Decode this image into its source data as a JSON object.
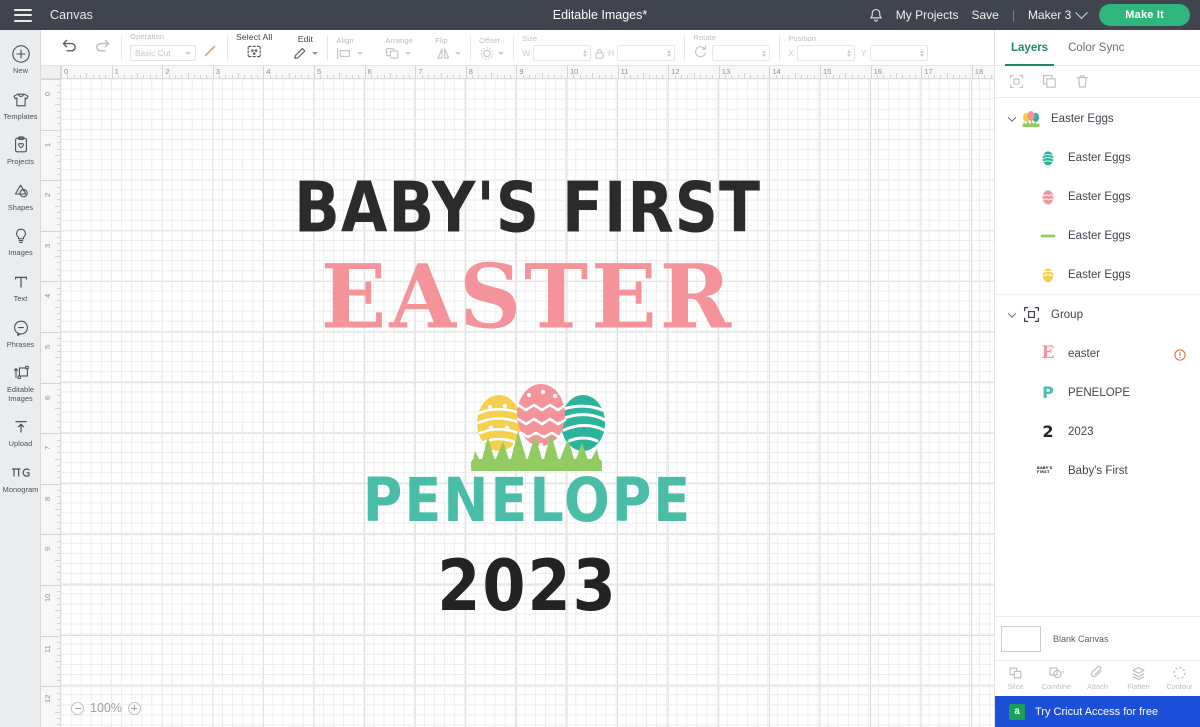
{
  "topbar": {
    "menu_icon": "hamburger-icon",
    "canvas_label": "Canvas",
    "title": "Editable Images*",
    "bell_icon": "notification-bell-icon",
    "my_projects": "My Projects",
    "save": "Save",
    "separator": "|",
    "machine": "Maker 3",
    "make_it": "Make It",
    "accent_green": "#2eb67d",
    "bar_bg": "#3f444e"
  },
  "rail": {
    "items": [
      {
        "label": "New",
        "icon": "plus-circle-icon"
      },
      {
        "label": "Templates",
        "icon": "tshirt-icon"
      },
      {
        "label": "Projects",
        "icon": "clipboard-heart-icon"
      },
      {
        "label": "Shapes",
        "icon": "shapes-icon"
      },
      {
        "label": "Images",
        "icon": "lightbulb-icon"
      },
      {
        "label": "Text",
        "icon": "text-t-icon"
      },
      {
        "label": "Phrases",
        "icon": "speech-bubble-icon"
      },
      {
        "label": "Editable\nImages",
        "icon": "editable-images-icon"
      },
      {
        "label": "Upload",
        "icon": "upload-arrow-icon"
      },
      {
        "label": "Monogram",
        "icon": "monogram-icon"
      }
    ]
  },
  "toolbar": {
    "undo": "undo-icon",
    "redo": "redo-icon",
    "operation_caption": "Operation",
    "operation_value": "Basic Cut",
    "select_all": "Select All",
    "edit": "Edit",
    "align": "Align",
    "arrange": "Arrange",
    "flip": "Flip",
    "offset": "Offset",
    "size": "Size",
    "size_w_label": "W",
    "size_w_value": "",
    "size_h_label": "H",
    "size_h_value": "",
    "lock_icon": "lock-icon",
    "rotate": "Rotate",
    "rotate_value": "",
    "position": "Position",
    "position_x_label": "X",
    "position_x_value": "",
    "position_y_label": "Y",
    "position_y_value": ""
  },
  "canvas": {
    "ruler_h_labels": [
      "0",
      "1",
      "2",
      "3",
      "4",
      "5",
      "6",
      "7",
      "8",
      "9",
      "10",
      "11",
      "12",
      "13",
      "14",
      "15",
      "16",
      "17",
      "18"
    ],
    "ruler_v_labels": [
      "0",
      "1",
      "2",
      "3",
      "4",
      "5",
      "6",
      "7",
      "8",
      "9",
      "10",
      "11",
      "12"
    ],
    "zoom_minus_icon": "zoom-out-icon",
    "zoom_level": "100%",
    "zoom_plus_icon": "zoom-in-icon",
    "design": {
      "line1": "BABY'S FIRST",
      "line1_color": "#2b2b2b",
      "line2": "EASTER",
      "line2_color": "#f4939a",
      "line3": "PENELOPE",
      "line3_color": "#49bda8",
      "line4": "2023",
      "line4_color": "#232323",
      "artwork": "easter-eggs-in-grass",
      "egg_colors": [
        "#f6cf4e",
        "#f4939a",
        "#2bb39c"
      ],
      "grass_color": "#92cb62"
    }
  },
  "right_panel": {
    "tabs": [
      {
        "label": "Layers",
        "active": true
      },
      {
        "label": "Color Sync",
        "active": false
      }
    ],
    "tools": [
      "group-icon",
      "duplicate-icon",
      "delete-icon"
    ],
    "layers": [
      {
        "label": "Easter Eggs",
        "type": "group",
        "expanded": true,
        "thumb": "multicolor-eggs-thumb",
        "thumb_color": "#92cb62",
        "children": [
          {
            "label": "Easter Eggs",
            "thumb": "teal-egg-thumb",
            "thumb_color": "#2bb39c"
          },
          {
            "label": "Easter Eggs",
            "thumb": "pink-egg-thumb",
            "thumb_color": "#f4939a"
          },
          {
            "label": "Easter Eggs",
            "thumb": "green-grass-thumb",
            "thumb_color": "#92cb62"
          },
          {
            "label": "Easter Eggs",
            "thumb": "yellow-egg-thumb",
            "thumb_color": "#f6cf4e"
          }
        ]
      },
      {
        "label": "Group",
        "type": "group",
        "expanded": true,
        "thumb": "group-icon",
        "children": [
          {
            "label": "easter",
            "thumb": "letter-e-pink",
            "thumb_color": "#f4939a",
            "warning": true
          },
          {
            "label": "PENELOPE",
            "thumb": "letter-p-teal",
            "thumb_color": "#49bda8"
          },
          {
            "label": "2023",
            "thumb": "digit-2-black",
            "thumb_color": "#232323"
          },
          {
            "label": "Baby's First",
            "thumb": "babys-first-thumb",
            "thumb_color": "#232323"
          }
        ]
      }
    ],
    "canvas_swatch_label": "Blank Canvas",
    "operations": [
      {
        "label": "Slice",
        "icon": "slice-icon"
      },
      {
        "label": "Combine",
        "icon": "combine-icon"
      },
      {
        "label": "Attach",
        "icon": "attach-icon"
      },
      {
        "label": "Flatten",
        "icon": "flatten-icon"
      },
      {
        "label": "Contour",
        "icon": "contour-icon"
      }
    ],
    "promo": {
      "badge": "a",
      "label": "Try Cricut Access for free",
      "bg": "#1c4fd8"
    }
  }
}
